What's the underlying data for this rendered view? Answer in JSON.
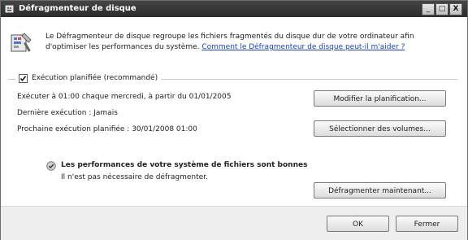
{
  "window": {
    "title": "Défragmenteur de disque",
    "minimize_glyph": "_",
    "maximize_glyph": "□",
    "close_glyph": "X"
  },
  "intro": {
    "icon": "defrag-icon",
    "text": "Le Défragmenteur de disque regroupe les fichiers fragmentés du disque dur de votre ordinateur afin d'optimiser les performances du système.",
    "help_link": "Comment le Défragmenteur de disque peut-il m'aider ?"
  },
  "schedule": {
    "checkbox_label": "Exécution planifiée (recommandé)",
    "checked": true,
    "run_line": "Exécuter à 01:00 chaque mercredi, à partir du 01/01/2005",
    "last_run": "Dernière exécution : Jamais",
    "next_run": "Prochaine exécution planifiée : 30/01/2008 01:00",
    "modify_button": "Modifier la planification...",
    "select_volumes_button": "Sélectionner des volumes..."
  },
  "status": {
    "icon": "status-ok-icon",
    "title": "Les performances de votre système de fichiers sont bonnes",
    "subtitle": "Il n'est pas nécessaire de défragmenter.",
    "defrag_button": "Défragmenter maintenant..."
  },
  "footer": {
    "ok_button": "OK",
    "close_button": "Fermer"
  }
}
